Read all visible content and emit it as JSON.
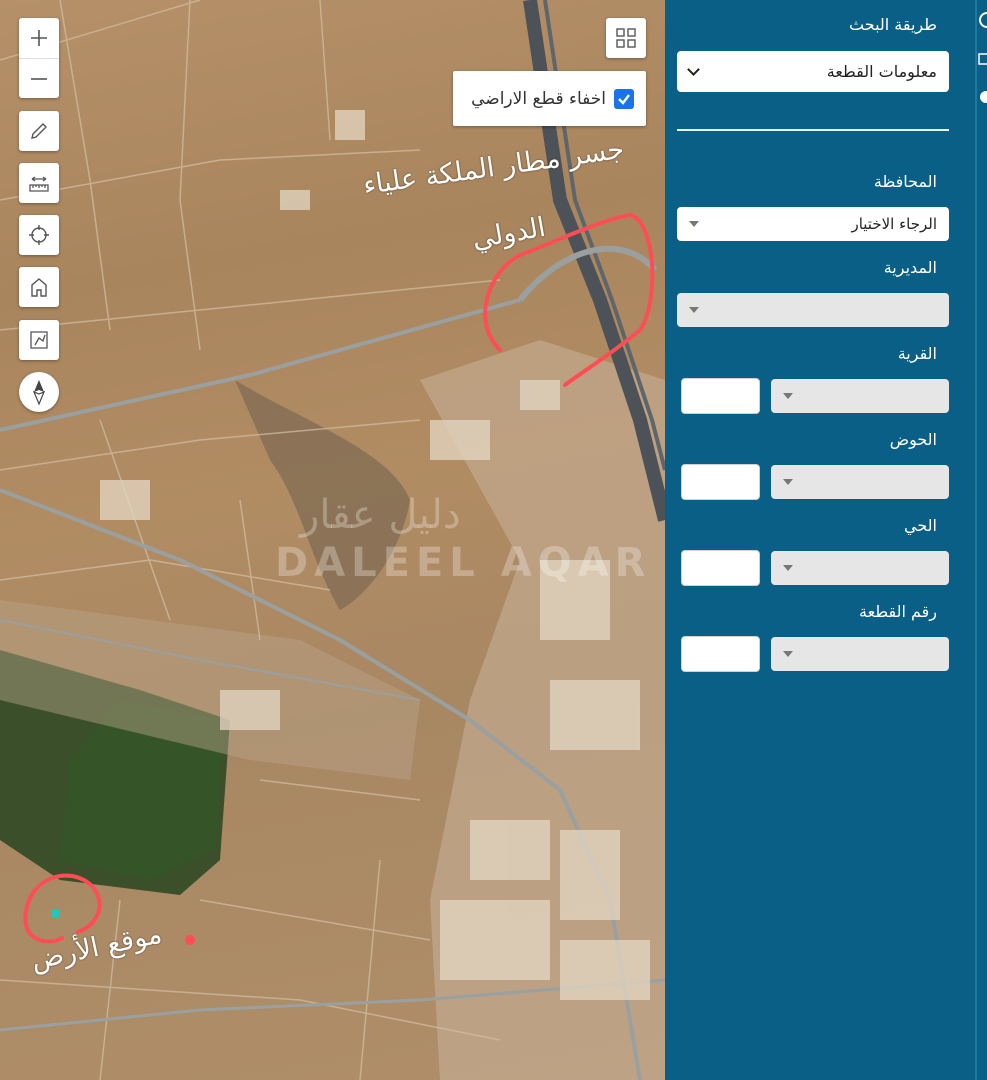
{
  "map": {
    "hide_parcels_label": "اخفاء قطع الاراضي",
    "hide_parcels_checked": true,
    "annotations": {
      "bridge_line1": "جسر مطار الملكة علياء",
      "bridge_line2": "الدولي",
      "land_location": "موقع الأرض"
    },
    "watermark_en": "DALEEL AQAR",
    "watermark_ar": "دليل عقار",
    "controls": [
      "zoom-in-icon",
      "zoom-out-icon",
      "pencil-icon",
      "ruler-icon",
      "locate-icon",
      "home-icon",
      "measure-area-icon",
      "compass-icon",
      "basemap-gallery-icon"
    ],
    "accent_color": "#ff4d55"
  },
  "panel": {
    "search_method_label": "طريقة البحث",
    "search_method_value": "معلومات القطعة",
    "governorate_label": "المحافظة",
    "governorate_value": "الرجاء الاختيار",
    "directorate_label": "المديرية",
    "village_label": "القرية",
    "basin_label": "الحوض",
    "district_label": "الحي",
    "parcel_number_label": "رقم القطعة",
    "bg_color": "#0a5f86"
  }
}
